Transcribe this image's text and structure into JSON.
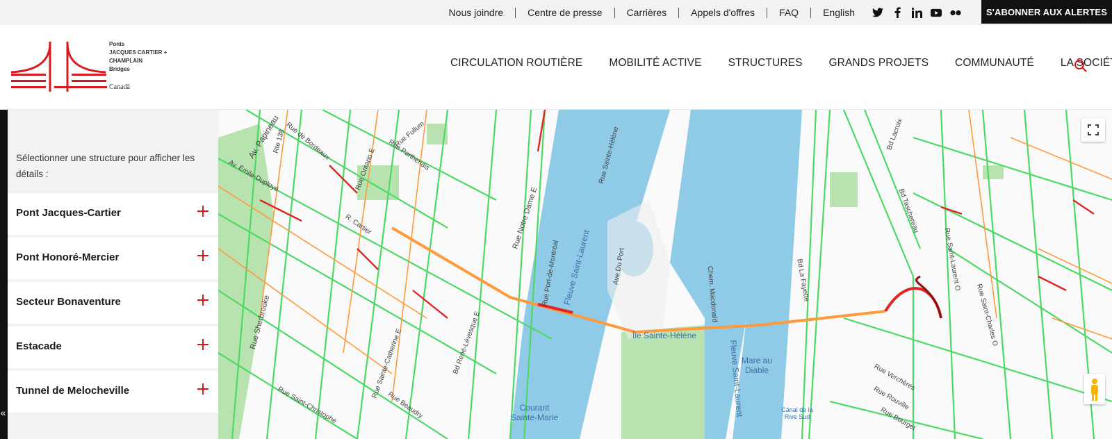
{
  "topbar": {
    "links": [
      "Nous joindre",
      "Centre de presse",
      "Carrières",
      "Appels d'offres",
      "FAQ",
      "English"
    ],
    "socials": [
      "twitter-icon",
      "facebook-icon",
      "linkedin-icon",
      "youtube-icon",
      "flickr-icon"
    ],
    "subscribe_label": "S'ABONNER AUX ALERTES"
  },
  "brand": {
    "line1": "Ponts",
    "line2": "JACQUES CARTIER +",
    "line3": "CHAMPLAIN",
    "line4": "Bridges",
    "canada": "Canadä",
    "color": "#d71920"
  },
  "nav": {
    "items": [
      "CIRCULATION ROUTIÈRE",
      "MOBILITÉ ACTIVE",
      "STRUCTURES",
      "GRANDS PROJETS",
      "COMMUNAUTÉ",
      "LA SOCIÉTÉ"
    ],
    "search_icon": "search-icon"
  },
  "sidebar": {
    "intro": "Sélectionner une structure pour afficher les détails :",
    "items": [
      "Pont Jacques-Cartier",
      "Pont Honoré-Mercier",
      "Secteur Bonaventure",
      "Estacade",
      "Tunnel de Melocheville"
    ],
    "collapse_icon": "«"
  },
  "map": {
    "labels": [
      "Av. Papineau",
      "Rte 138",
      "Rue de Bordeaux",
      "R. Cartier",
      "Av. Émile-Duployé",
      "Rue Sherbrooke",
      "Rue Ontario E",
      "Rue Fullum",
      "Rue Parthenais",
      "Rue Notre Dame E",
      "Rue Port-de-Montréal",
      "Bd René-Lévesque E",
      "Rue Sainte-Catherine E",
      "Bd Lacroix",
      "Bd Taschereau",
      "Rue Saint-Laurent O",
      "Bd La Fayette",
      "Rue Saint-Charles O",
      "Rue Sainte-Hélène",
      "Ave Du Port",
      "Chem. Macdonald",
      "Rue Verchères",
      "Rue Rouville",
      "Rue Bourget",
      "Rue Beaudry",
      "Rue Saint-Christophe"
    ],
    "water_labels": [
      "Fleuve Saint-Laurent",
      "Fleuve Saint-Laurent",
      "Courant Sainte-Marie",
      "Mare au Diable",
      "Canal de la Rive Sud"
    ],
    "place_label": "Île Sainte-Hélène",
    "colors": {
      "water": "#8fcbe6",
      "park": "#b8e2b0",
      "green": "#4cd964",
      "orange": "#ff9a3c",
      "red": "#e02525",
      "darkred": "#8b1010"
    }
  }
}
